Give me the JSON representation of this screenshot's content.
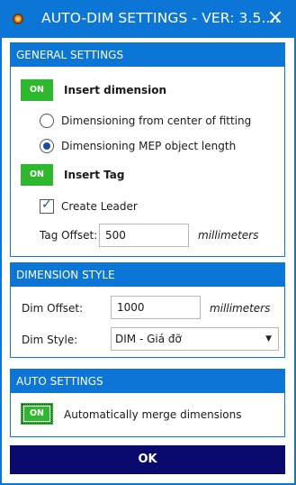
{
  "window": {
    "title": "AUTO-DIM SETTINGS - VER: 3.5....",
    "icon": "app-settings-icon",
    "close_glyph": "×"
  },
  "general": {
    "header": "GENERAL SETTINGS",
    "insert_dimension": {
      "toggle": "ON",
      "label": "Insert dimension",
      "enabled": true
    },
    "options": [
      {
        "label": "Dimensioning from center of fitting",
        "selected": false
      },
      {
        "label": "Dimensioning MEP object length",
        "selected": true
      }
    ],
    "insert_tag": {
      "toggle": "ON",
      "label": "Insert Tag",
      "enabled": true
    },
    "create_leader": {
      "label": "Create Leader",
      "checked": true,
      "glyph": "✓"
    },
    "tag_offset": {
      "label": "Tag Offset:",
      "value": "500",
      "unit": "millimeters"
    }
  },
  "dimension_style": {
    "header": "DIMENSION STYLE",
    "dim_offset": {
      "label": "Dim Offset:",
      "value": "1000",
      "unit": "millimeters"
    },
    "dim_style": {
      "label": "Dim Style:",
      "value": "DIM - Giá đỡ",
      "arrow": "▼"
    }
  },
  "auto_settings": {
    "header": "AUTO SETTINGS",
    "merge": {
      "toggle": "ON",
      "label": "Automatically merge dimensions",
      "enabled": true
    }
  },
  "ok_label": "OK",
  "colors": {
    "accent": "#0b76d6",
    "toggle_on": "#2eb82e",
    "ok_button": "#0a0a6e"
  }
}
